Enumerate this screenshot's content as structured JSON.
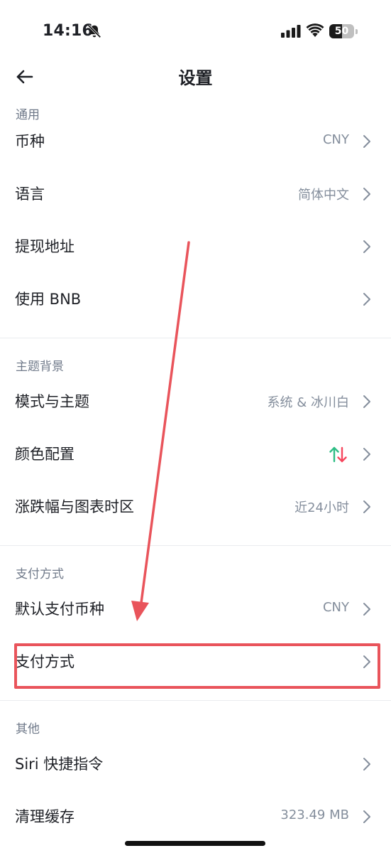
{
  "status": {
    "time": "14:16",
    "battery_level": "50",
    "battery_fraction": 0.5,
    "icons": [
      "bell-slash-icon",
      "signal-icon",
      "wifi-icon",
      "battery-icon"
    ]
  },
  "header": {
    "title": "设置",
    "back_icon": "arrow-left-icon"
  },
  "sections": {
    "general": {
      "label": "通用",
      "items": [
        {
          "label": "币种",
          "value": "CNY"
        },
        {
          "label": "语言",
          "value": "简体中文"
        },
        {
          "label": "提现地址",
          "value": ""
        },
        {
          "label": "使用 BNB",
          "value": ""
        }
      ]
    },
    "theme": {
      "label": "主题背景",
      "items": [
        {
          "label": "模式与主题",
          "value": "系统 & 冰川白"
        },
        {
          "label": "颜色配置",
          "value": ""
        },
        {
          "label": "涨跌幅与图表时区",
          "value": "近24小时"
        }
      ]
    },
    "payment": {
      "label": "支付方式",
      "items": [
        {
          "label": "默认支付币种",
          "value": "CNY"
        },
        {
          "label": "支付方式",
          "value": ""
        }
      ]
    },
    "other": {
      "label": "其他",
      "items": [
        {
          "label": "Siri 快捷指令",
          "value": ""
        },
        {
          "label": "清理缓存",
          "value": "323.49 MB"
        }
      ]
    }
  },
  "colors": {
    "up": "#2ebd85",
    "down": "#f6465d",
    "annotation": "#e9545b"
  }
}
